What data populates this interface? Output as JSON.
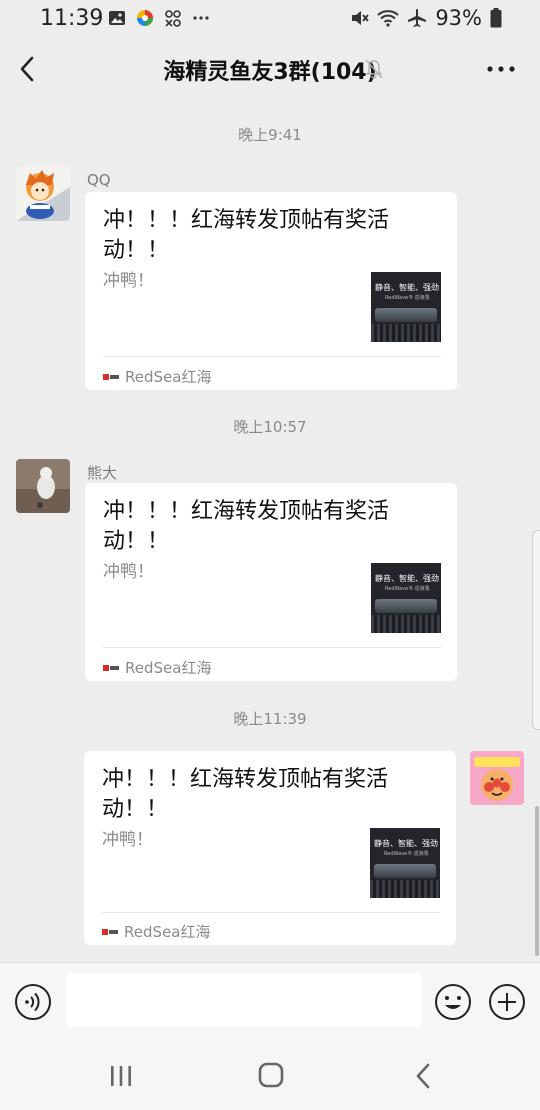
{
  "status_bar": {
    "time": "11:39",
    "battery": "93%",
    "icons": [
      "gallery-icon",
      "app-icon",
      "game-icon",
      "more-dots-icon",
      "mute-icon",
      "wifi-icon",
      "airplane-icon",
      "battery-icon"
    ]
  },
  "header": {
    "title": "海精灵鱼友3群(104)",
    "back_icon": "back-chevron-icon",
    "mute_icon": "bell-muted-icon",
    "more_icon": "more-horizontal-icon"
  },
  "messages": [
    {
      "time": "晚上9:41",
      "sender": "QQ",
      "title": "冲！！！红海转发顶帖有奖活动！！",
      "desc": "冲鸭！",
      "thumb_text": "静音、智能、强劲",
      "thumb_sub": "RedWave® 造浪泵",
      "source": "RedSea红海"
    },
    {
      "time": "晚上10:57",
      "sender": "熊大",
      "title": "冲！！！红海转发顶帖有奖活动！！",
      "desc": "冲鸭！",
      "thumb_text": "静音、智能、强劲",
      "thumb_sub": "RedWave® 造浪泵",
      "source": "RedSea红海"
    },
    {
      "time": "晚上11:39",
      "sender": "",
      "title": "冲！！！红海转发顶帖有奖活动！！",
      "desc": "冲鸭！",
      "thumb_text": "静音、智能、强劲",
      "thumb_sub": "RedWave® 造浪泵",
      "source": "RedSea红海"
    }
  ],
  "input_bar": {
    "placeholder": "",
    "voice_icon": "voice-icon",
    "emoji_icon": "emoji-icon",
    "plus_icon": "plus-circle-icon"
  },
  "nav_bar": {
    "icons": [
      "recent-apps-icon",
      "home-icon",
      "back-icon"
    ]
  },
  "colors": {
    "background": "#ededed",
    "card": "#ffffff",
    "secondary_text": "#8b8b8b"
  }
}
